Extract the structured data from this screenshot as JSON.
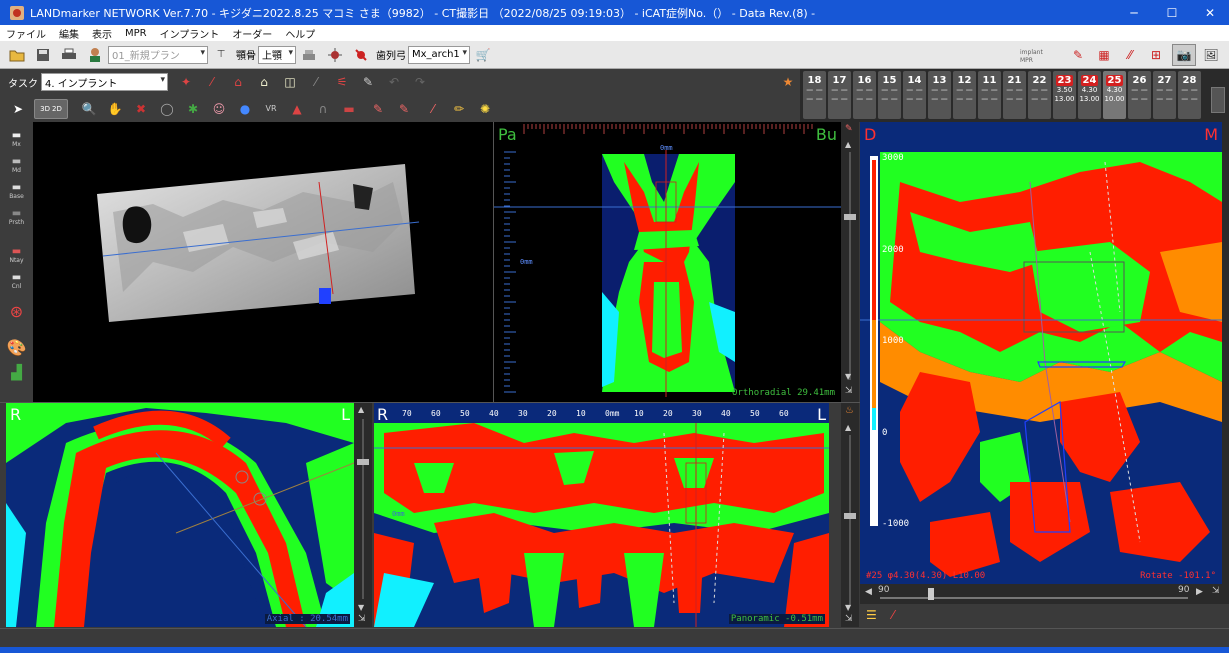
{
  "window": {
    "title": "LANDmarker NETWORK Ver.7.70 - キジダニ2022.8.25 マコミ さま（9982） - CT撮影日 （2022/08/25 09:19:03） - iCAT症例No.（） - Data Rev.(8) -",
    "minimize": "─",
    "maximize": "☐",
    "close": "✕"
  },
  "menu": [
    "ファイル",
    "編集",
    "表示",
    "MPR",
    "インプラント",
    "オーダー",
    "ヘルプ"
  ],
  "toolbar1": {
    "plan_select": "01_新規プラン",
    "jaw_label": "顎骨",
    "jaw_select": "上顎",
    "arch_label": "歯列弓",
    "arch_select": "Mx_arch1",
    "implant_mpr_label": "implant MPR"
  },
  "toolbar2": {
    "task_label": "タスク",
    "task_select": "4. インプラント"
  },
  "toolbar3": {
    "mode_3d": "3D",
    "mode_2d": "2D"
  },
  "teeth": [
    {
      "num": "18",
      "a": "",
      "b": ""
    },
    {
      "num": "17",
      "a": "",
      "b": ""
    },
    {
      "num": "16",
      "a": "",
      "b": ""
    },
    {
      "num": "15",
      "a": "",
      "b": ""
    },
    {
      "num": "14",
      "a": "",
      "b": ""
    },
    {
      "num": "13",
      "a": "",
      "b": ""
    },
    {
      "num": "12",
      "a": "",
      "b": ""
    },
    {
      "num": "11",
      "a": "",
      "b": ""
    },
    {
      "num": "21",
      "a": "",
      "b": ""
    },
    {
      "num": "22",
      "a": "",
      "b": ""
    },
    {
      "num": "23",
      "a": "3.50",
      "b": "13.00",
      "red": true
    },
    {
      "num": "24",
      "a": "4.30",
      "b": "13.00",
      "red": true
    },
    {
      "num": "25",
      "a": "4.30",
      "b": "10.00",
      "red": true,
      "active": true
    },
    {
      "num": "26",
      "a": "",
      "b": ""
    },
    {
      "num": "27",
      "a": "",
      "b": ""
    },
    {
      "num": "28",
      "a": "",
      "b": ""
    }
  ],
  "left_tools": [
    "Mx",
    "Md",
    "Base",
    "Prsth",
    "Ntay",
    "Cnl"
  ],
  "views": {
    "ortho": {
      "left": "Pa",
      "right": "Bu",
      "top_mark": "0mm",
      "mid_mark": "0mm",
      "footer": "Orthoradial 29.41mm"
    },
    "axial": {
      "left": "R",
      "right": "L",
      "footer": "Axial : 20.54mm"
    },
    "pano": {
      "left": "R",
      "right": "L",
      "footer": "Panoramic -0.51mm",
      "mid_mark": "0mm",
      "ticks": [
        "70",
        "60",
        "50",
        "40",
        "30",
        "20",
        "10",
        "0mm",
        "10",
        "20",
        "30",
        "40",
        "50",
        "60"
      ]
    },
    "implant": {
      "left": "D",
      "right": "M",
      "footer_left": "#25 φ4.30(4.30) L10.00",
      "footer_right": "Rotate -101.1°",
      "scale": [
        "3000",
        "2000",
        "1000",
        "0",
        "-1000"
      ],
      "slider_left": "90",
      "slider_right": "90"
    }
  },
  "colors": {
    "accent": "#1757d6",
    "hu_red": "#ff1e00",
    "hu_green": "#21ff21",
    "hu_blue": "#0a2a7a",
    "hu_cyan": "#11f0ff",
    "hu_orange": "#ff8c00"
  }
}
